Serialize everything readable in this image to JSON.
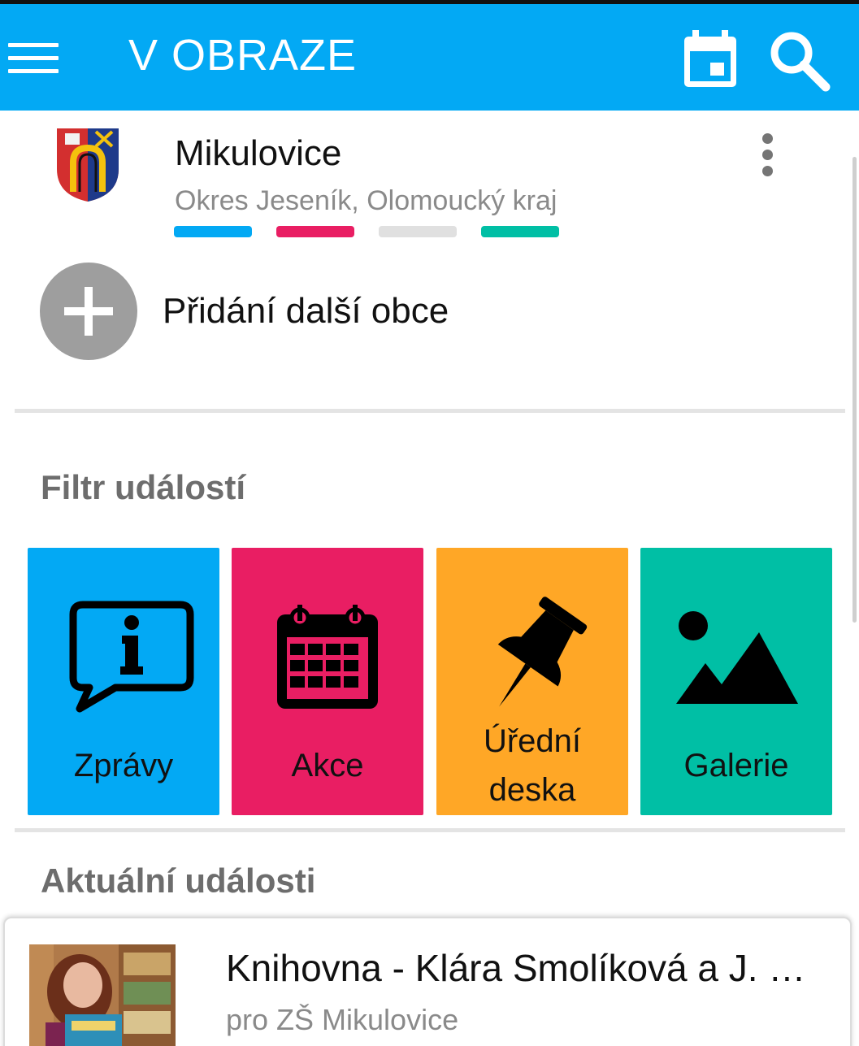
{
  "appbar": {
    "title": "V OBRAZE",
    "menu_icon": "hamburger-menu-icon",
    "calendar_icon": "calendar-icon",
    "search_icon": "search-icon",
    "color": "#03a9f4"
  },
  "municipality": {
    "name": "Mikulovice",
    "region": "Okres Jeseník, Olomoucký kraj",
    "crest_icon": "coat-of-arms-icon",
    "color_bars": [
      "#03a9f4",
      "#e91e63",
      "#e0e0e0",
      "#00bfa5"
    ],
    "more_icon": "more-vertical-icon"
  },
  "add_municipality": {
    "label": "Přidání další obce",
    "icon": "plus-icon"
  },
  "filter": {
    "title": "Filtr událostí",
    "tiles": [
      {
        "label": "Zprávy",
        "icon": "info-speech-icon",
        "color": "#03a9f4"
      },
      {
        "label": "Akce",
        "icon": "calendar-icon",
        "color": "#e91e63"
      },
      {
        "label_line1": "Úřední",
        "label_line2": "deska",
        "icon": "pushpin-icon",
        "color": "#ffa726"
      },
      {
        "label": "Galerie",
        "icon": "image-landscape-icon",
        "color": "#00bfa5"
      }
    ]
  },
  "current_events": {
    "title": "Aktuální události",
    "items": [
      {
        "title": "Knihovna - Klára Smolíková a J. …",
        "subtitle": "pro ZŠ Mikulovice"
      }
    ]
  }
}
